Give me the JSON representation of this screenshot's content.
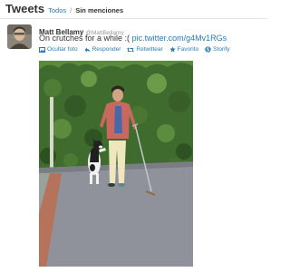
{
  "header": {
    "title": "Tweets",
    "tab_all": "Todos",
    "separator": "/",
    "tab_no_mentions": "Sin menciones"
  },
  "tweet": {
    "author_name": "Matt Bellamy",
    "author_handle": "@MattBellamy",
    "text": "On crutches for a while :(",
    "link": "pic.twitter.com/g4Mv1RGs",
    "actions": {
      "hide_photo": "Ocultar foto",
      "reply": "Responder",
      "retweet": "Retwittear",
      "favorite": "Favorito",
      "storify": "Storify"
    }
  },
  "colors": {
    "link": "#2b7bb9",
    "text": "#333333",
    "muted": "#999999"
  },
  "icons": [
    "photo-icon",
    "reply-icon",
    "retweet-icon",
    "star-icon",
    "storify-icon"
  ]
}
